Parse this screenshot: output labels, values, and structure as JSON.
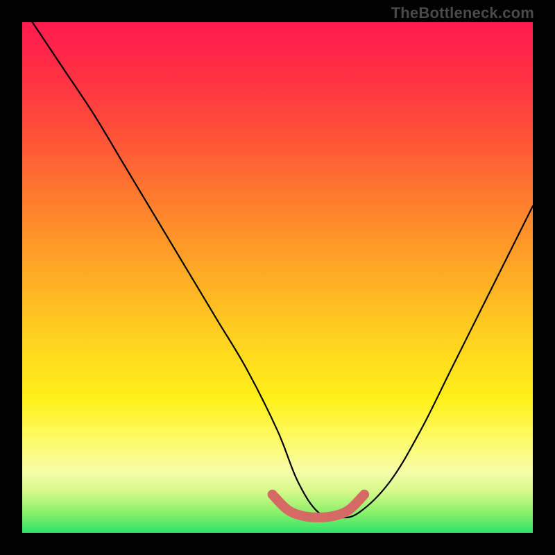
{
  "watermark": "TheBottleneck.com",
  "colors": {
    "curve": "#000000",
    "bump": "#d46a63",
    "frame_bg": "#000000"
  },
  "chart_data": {
    "type": "line",
    "title": "",
    "xlabel": "",
    "ylabel": "",
    "xlim": [
      0,
      100
    ],
    "ylim": [
      0,
      100
    ],
    "grid": false,
    "legend": false,
    "series": [
      {
        "name": "curve",
        "x": [
          2,
          8,
          14,
          20,
          26,
          32,
          38,
          44,
          50,
          54,
          58,
          62,
          66,
          72,
          78,
          84,
          90,
          96,
          100
        ],
        "y": [
          100,
          91,
          82,
          72,
          62,
          52,
          42,
          32,
          20,
          10,
          4,
          3,
          4,
          10,
          20,
          32,
          44,
          56,
          64
        ]
      },
      {
        "name": "bottom-bump",
        "x": [
          49,
          52,
          55,
          58,
          61,
          64,
          67
        ],
        "y": [
          7.5,
          4.5,
          3.3,
          3.0,
          3.3,
          4.5,
          7.5
        ]
      }
    ]
  }
}
